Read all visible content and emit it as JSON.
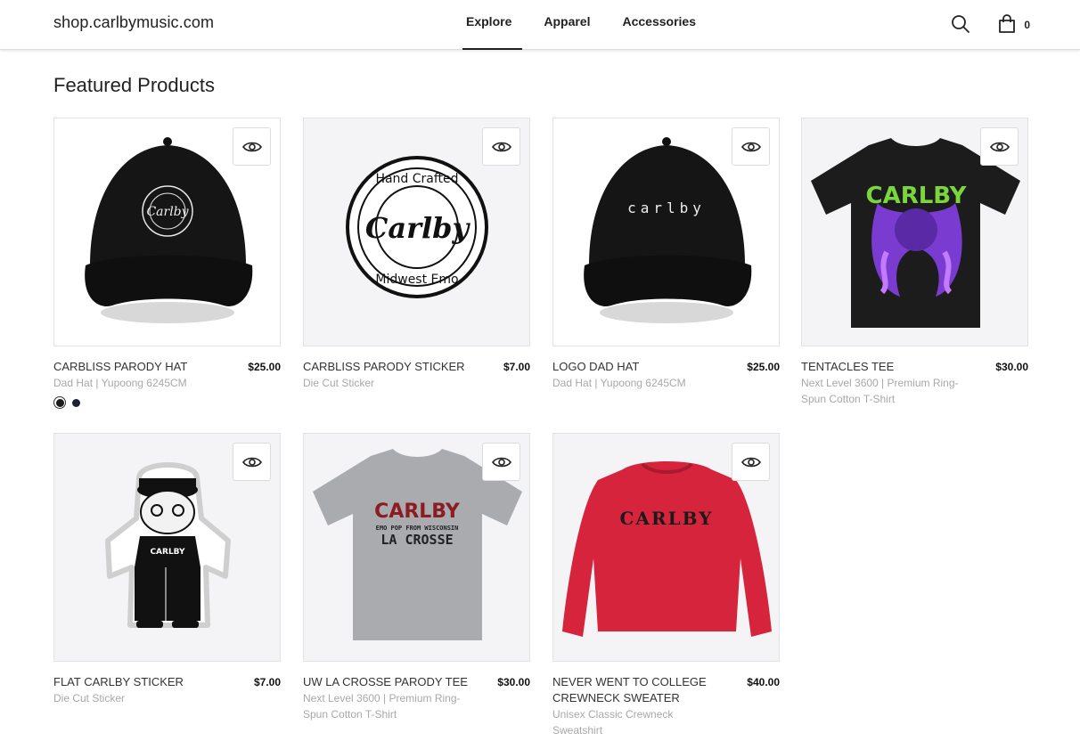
{
  "header": {
    "site_title": "shop.carlbymusic.com",
    "nav": [
      {
        "label": "Explore",
        "active": true
      },
      {
        "label": "Apparel",
        "active": false
      },
      {
        "label": "Accessories",
        "active": false
      }
    ],
    "search_icon": "search-icon",
    "cart_icon": "shopping-bag-icon",
    "cart_count": "0"
  },
  "main": {
    "section_title": "Featured Products",
    "products": [
      {
        "name": "CARBLISS PARODY HAT",
        "price": "$25.00",
        "desc": "Dad Hat | Yupoong 6245CM",
        "image": "black cap with circular Hand Crafted Carlby Midwest Emo logo",
        "swatches": [
          {
            "color": "#1b1b1b",
            "selected": true
          },
          {
            "color": "#1c2333",
            "selected": false
          }
        ]
      },
      {
        "name": "CARBLISS PARODY STICKER",
        "price": "$7.00",
        "desc": "Die Cut Sticker",
        "image": "round Hand Crafted Carlby Midwest Emo sticker",
        "logo": {
          "top": "Hand Crafted",
          "center": "Carlby",
          "bottom": "Midwest Emo"
        }
      },
      {
        "name": "LOGO DAD HAT",
        "price": "$25.00",
        "desc": "Dad Hat | Yupoong 6245CM",
        "image": "black cap with carlby script",
        "cap_text": "carlby"
      },
      {
        "name": "TENTACLES TEE",
        "price": "$30.00",
        "desc": "Next Level 3600 | Premium Ring-Spun Cotton T-Shirt",
        "image": "black tee with purple tentacles and green CARLBY logo",
        "shirt_text": "CARLBY"
      },
      {
        "name": "FLAT CARLBY STICKER",
        "price": "$7.00",
        "desc": "Die Cut Sticker",
        "image": "cartoon character sticker",
        "shirt_text": "CARLBY"
      },
      {
        "name": "UW LA CROSSE PARODY TEE",
        "price": "$30.00",
        "desc": "Next Level 3600 | Premium Ring-Spun Cotton T-Shirt",
        "image": "grey tee with CARLBY LA CROSSE print",
        "print": {
          "line1": "CARLBY",
          "line2": "EMO POP FROM WISCONSIN",
          "line3": "LA CROSSE"
        }
      },
      {
        "name": "NEVER WENT TO COLLEGE CREWNECK SWEATER",
        "price": "$40.00",
        "desc": "Unisex Classic Crewneck Sweatshirt",
        "image": "red crewneck with arched CARLBY print",
        "print": {
          "line1": "CARLBY"
        }
      }
    ]
  }
}
